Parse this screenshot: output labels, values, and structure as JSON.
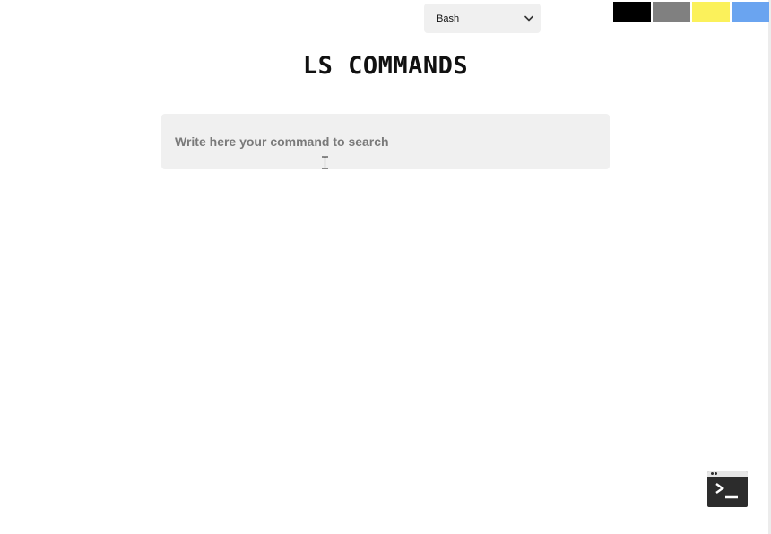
{
  "language_select": {
    "selected": "Bash",
    "icon": "chevron-down-icon"
  },
  "theme_swatches": [
    {
      "name": "black",
      "color": "#000000"
    },
    {
      "name": "gray",
      "color": "#808080"
    },
    {
      "name": "yellow",
      "color": "#fbf15b"
    },
    {
      "name": "blue",
      "color": "#6aa4f0"
    }
  ],
  "header": {
    "title": "LS COMMANDS"
  },
  "search": {
    "value": "",
    "placeholder": "Write here your command to search"
  },
  "terminal_button": {
    "icon": "terminal-icon"
  }
}
